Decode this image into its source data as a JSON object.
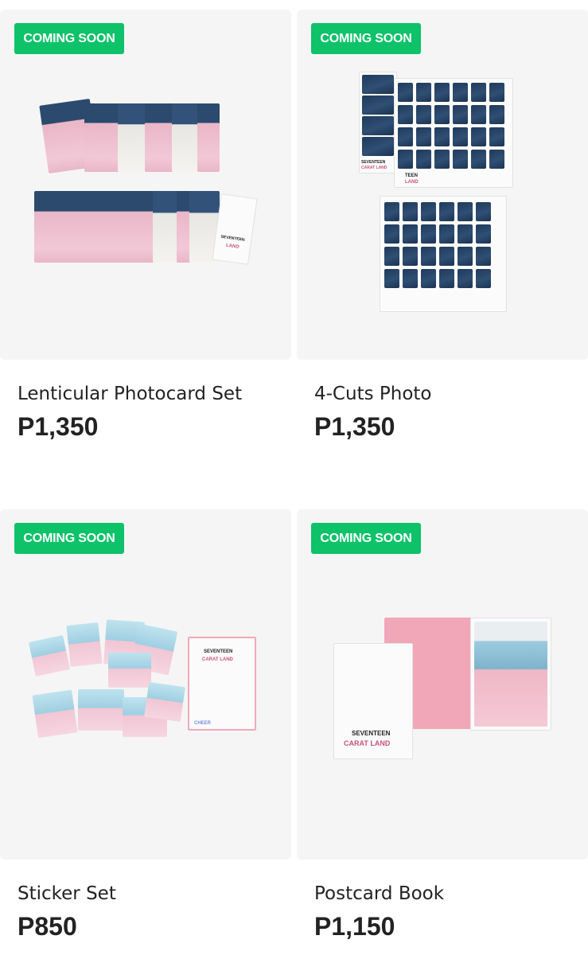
{
  "products": [
    {
      "badge": "COMING SOON",
      "name": "Lenticular Photocard Set",
      "price": "P1,350",
      "image": "lenticular-photocard-set-image"
    },
    {
      "badge": "COMING SOON",
      "name": "4-Cuts Photo",
      "price": "P1,350",
      "image": "4-cuts-photo-image"
    },
    {
      "badge": "COMING SOON",
      "name": "Sticker Set",
      "price": "P850",
      "image": "sticker-set-image"
    },
    {
      "badge": "COMING SOON",
      "name": "Postcard Book",
      "price": "P1,150",
      "image": "postcard-book-image"
    }
  ],
  "colors": {
    "badge": "#0dc269",
    "card_background": "#f5f5f5",
    "text": "#222222"
  },
  "product_art_text": {
    "group": "SEVENTEEN",
    "title": "CARAT LAND",
    "short": "TEEN",
    "subtitle": "LAND",
    "sticker_word": "CHEER"
  }
}
